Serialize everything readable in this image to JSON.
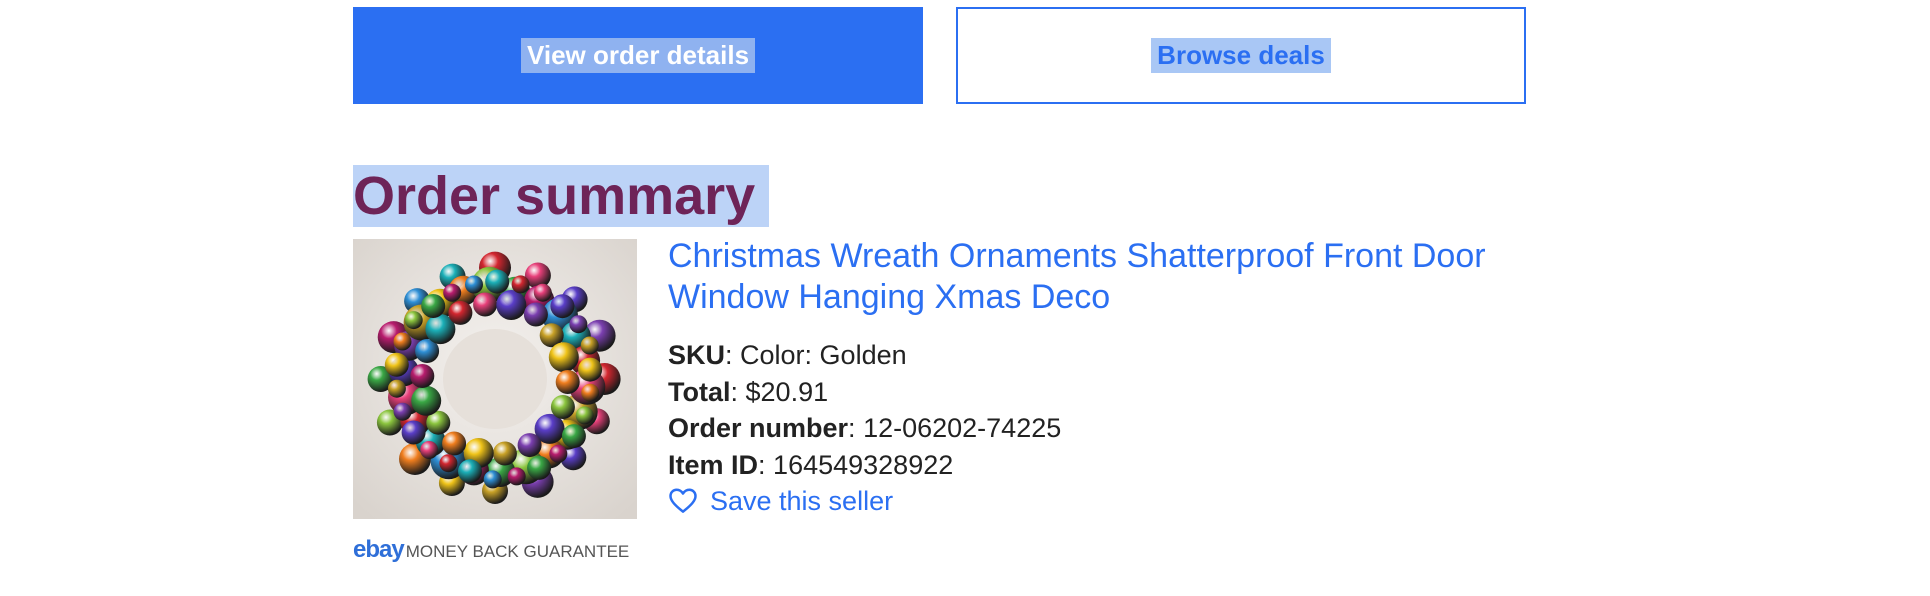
{
  "buttons": {
    "view_order": "View order details",
    "browse_deals": "Browse deals"
  },
  "section_title": "Order summary",
  "item": {
    "title": "Christmas Wreath Ornaments Shatterproof Front Door Window Hanging Xmas Deco",
    "image_icon": "christmas-wreath-image",
    "details": [
      {
        "label": "SKU",
        "value": "Color: Golden"
      },
      {
        "label": "Total",
        "value": "$20.91"
      },
      {
        "label": "Order number",
        "value": "12-06202-74225"
      },
      {
        "label": "Item ID",
        "value": "164549328922"
      }
    ],
    "save_seller": "Save this seller",
    "save_icon": "heart-icon"
  },
  "guarantee": {
    "logo": "ebay",
    "text": "MONEY BACK GUARANTEE"
  },
  "colors": {
    "primary": "#2b6ff2",
    "title": "#6e2458",
    "highlight": "#bcd3f7"
  }
}
